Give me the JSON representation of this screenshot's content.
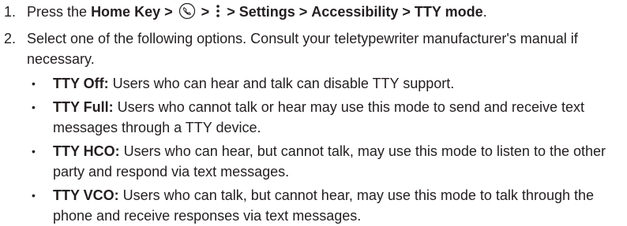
{
  "steps": [
    {
      "number": "1.",
      "prefix": "Press the",
      "path": [
        "Home Key",
        "Settings",
        "Accessibility",
        "TTY mode"
      ],
      "separator": ">",
      "period": ".",
      "icons": [
        "phone-icon",
        "more-vertical-icon"
      ]
    },
    {
      "number": "2.",
      "text": "Select one of the following options. Consult your teletypewriter manufacturer's manual if necessary."
    }
  ],
  "options": [
    {
      "title": "TTY Off:",
      "text": " Users who can hear and talk can disable TTY support."
    },
    {
      "title": "TTY Full:",
      "text": " Users who cannot talk or hear may use this mode to send and receive text messages through a TTY device."
    },
    {
      "title": "TTY HCO:",
      "text": " Users who can hear, but cannot talk, may use this mode to listen to the other party and respond via text messages."
    },
    {
      "title": "TTY VCO:",
      "text": " Users who can talk, but cannot hear, may use this mode to talk through the phone and receive responses via text messages."
    }
  ],
  "bullet_glyph": "•"
}
